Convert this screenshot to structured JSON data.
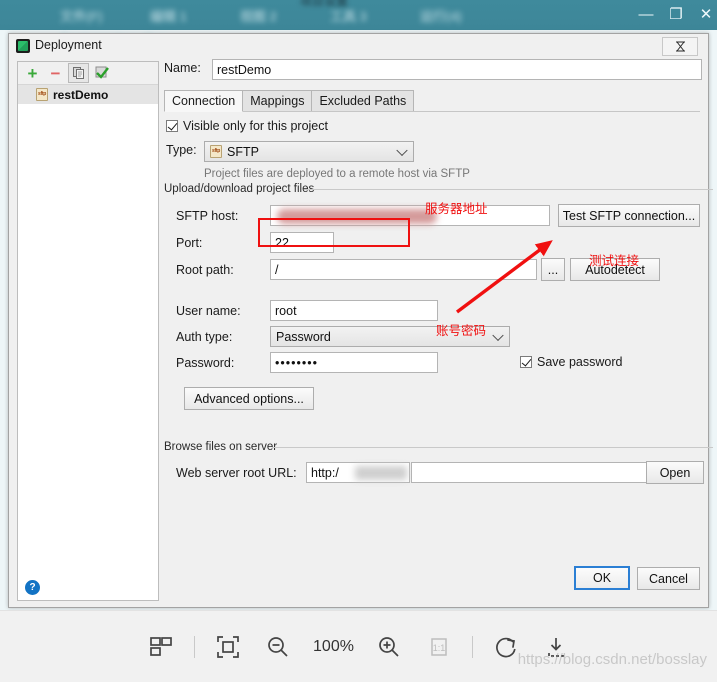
{
  "background_window": {
    "title_blur_segments": [
      "文件管理",
      "工具",
      "窗口",
      "帮助"
    ],
    "buttons": {
      "minimize": "—",
      "maximize": "□",
      "close": "✕"
    }
  },
  "dialog": {
    "title": "Deployment",
    "app_icon": "pycharm-icon",
    "corner_button_icon": "resize-icon",
    "sidebar": {
      "toolbar": [
        {
          "name": "add-button",
          "glyph": "+"
        },
        {
          "name": "remove-button",
          "glyph": "−"
        },
        {
          "name": "copy-button",
          "glyph": "copy-icon"
        },
        {
          "name": "set-default-button",
          "glyph": "check-icon"
        }
      ],
      "items": [
        {
          "label": "restDemo",
          "icon": "sftp-icon",
          "selected": true
        }
      ]
    },
    "name_field": {
      "label": "Name:",
      "value": "restDemo"
    },
    "tabs": [
      {
        "label": "Connection",
        "active": true
      },
      {
        "label": "Mappings",
        "active": false
      },
      {
        "label": "Excluded Paths",
        "active": false
      }
    ],
    "visible_only": {
      "label": "Visible only for this project",
      "checked": true
    },
    "type_row": {
      "label": "Type:",
      "value": "SFTP",
      "icon": "sftp-icon"
    },
    "type_hint": "Project files are deployed to a remote host via SFTP",
    "upload_group": {
      "title": "Upload/download project files",
      "sftp_host": {
        "label": "SFTP host:",
        "value": "",
        "redacted": true
      },
      "test_button": "Test SFTP connection...",
      "port": {
        "label": "Port:",
        "value": "22"
      },
      "root_path": {
        "label": "Root path:",
        "value": "/"
      },
      "browse_button": "...",
      "autodetect_button": "Autodetect",
      "user_name": {
        "label": "User name:",
        "value": "root"
      },
      "auth_type": {
        "label": "Auth type:",
        "value": "Password"
      },
      "password": {
        "label": "Password:",
        "value": "••••••••"
      },
      "save_password": {
        "label": "Save password",
        "checked": true
      },
      "advanced_button": "Advanced options..."
    },
    "browse_group": {
      "title": "Browse files on server",
      "web_root": {
        "label": "Web server root URL:",
        "value": "http:/",
        "redacted": true
      },
      "open_button": "Open"
    },
    "footer": {
      "help_icon": "help-icon",
      "ok_button": "OK",
      "cancel_button": "Cancel"
    }
  },
  "annotations": [
    {
      "text": "服务器地址",
      "name": "annotation-server-address"
    },
    {
      "text": "测试连接",
      "name": "annotation-test-connection"
    },
    {
      "text": "账号密码",
      "name": "annotation-account-password"
    }
  ],
  "viewer_toolbar": {
    "items": [
      {
        "name": "thumbnails-icon"
      },
      {
        "name": "fit-to-screen-icon"
      },
      {
        "name": "zoom-out-icon"
      },
      {
        "name": "zoom-level",
        "label": "100%"
      },
      {
        "name": "zoom-in-icon"
      },
      {
        "name": "actual-size-icon",
        "label": "1:1"
      },
      {
        "name": "rotate-icon"
      },
      {
        "name": "download-icon"
      }
    ],
    "zoom_level": "100%",
    "actual_size_label": "1:1"
  },
  "watermark": "https://blog.csdn.net/bosslay",
  "colors": {
    "accent": "#2b7fd4",
    "annotation_red": "#f01010",
    "titlebar_teal": "#3f8a9c"
  }
}
